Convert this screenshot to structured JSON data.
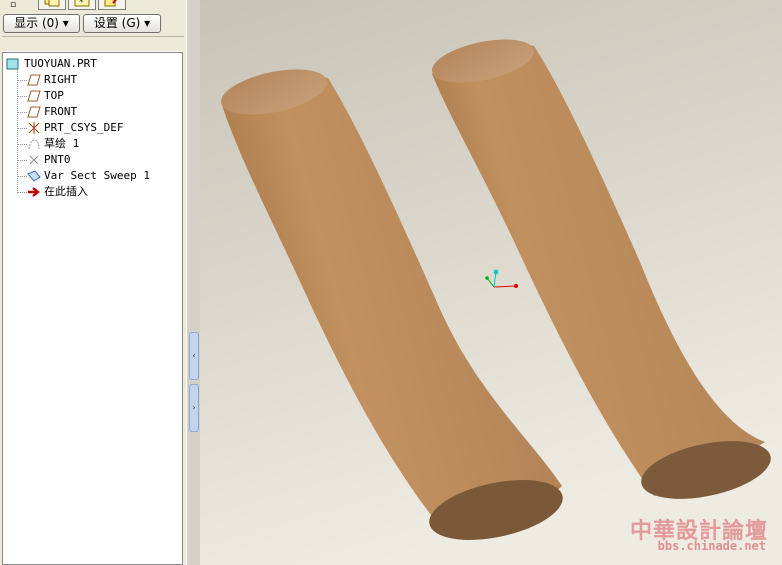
{
  "toolbar": {
    "show_button": "显示 (0) ▾",
    "settings_button": "设置 (G) ▾"
  },
  "model_tree": {
    "root": "TUOYUAN.PRT",
    "items": [
      {
        "label": "RIGHT",
        "icon": "datum-plane-icon"
      },
      {
        "label": "TOP",
        "icon": "datum-plane-icon"
      },
      {
        "label": "FRONT",
        "icon": "datum-plane-icon"
      },
      {
        "label": "PRT_CSYS_DEF",
        "icon": "coordinate-system-icon"
      },
      {
        "label": "草绘 1",
        "icon": "sketch-icon"
      },
      {
        "label": "PNT0",
        "icon": "datum-point-icon"
      },
      {
        "label": "Var Sect Sweep 1",
        "icon": "sweep-feature-icon"
      },
      {
        "label": "在此插入",
        "icon": "insert-here-arrow-icon"
      }
    ]
  },
  "watermark": {
    "title": "中華設計論壇",
    "url": "bbs.chinade.net"
  },
  "colors": {
    "model": "#b88a5c",
    "background_top": "#c9c4b8",
    "background_bottom": "#ece9e0"
  }
}
